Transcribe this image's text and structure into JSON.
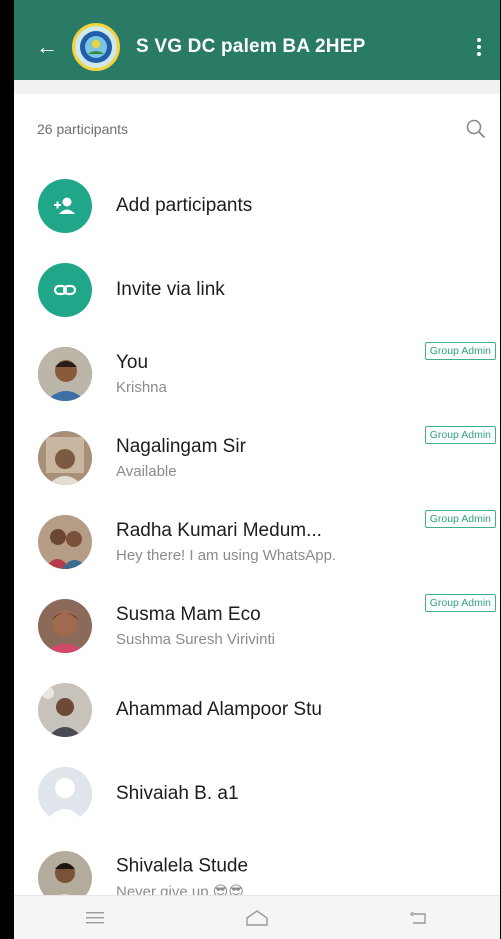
{
  "header": {
    "title": "S VG DC palem  BA 2HEP",
    "back_icon": "arrow-left-icon",
    "menu_icon": "more-vertical-icon",
    "bg_color": "#2a7b66"
  },
  "participants": {
    "count_label": "26 participants"
  },
  "actions": {
    "add": "Add participants",
    "invite": "Invite via link"
  },
  "members": [
    {
      "name": "You",
      "status": "Krishna",
      "badge": "Group Admin"
    },
    {
      "name": "Nagalingam Sir",
      "status": "Available",
      "badge": "Group Admin"
    },
    {
      "name": "Radha Kumari Medum...",
      "status": "Hey there! I am using WhatsApp.",
      "badge": "Group Admin"
    },
    {
      "name": "Susma Mam Eco",
      "status": "Sushma Suresh Virivinti",
      "badge": "Group Admin"
    },
    {
      "name": "Ahammad Alampoor Stu",
      "status": "",
      "badge": ""
    },
    {
      "name": "Shivaiah B. a1",
      "status": "",
      "badge": ""
    },
    {
      "name": "Shivalela Stude",
      "status": "Never give up 😎😎",
      "badge": ""
    }
  ],
  "navbar": {
    "icons": [
      "menu-lines-icon",
      "home-icon",
      "back-icon"
    ]
  }
}
